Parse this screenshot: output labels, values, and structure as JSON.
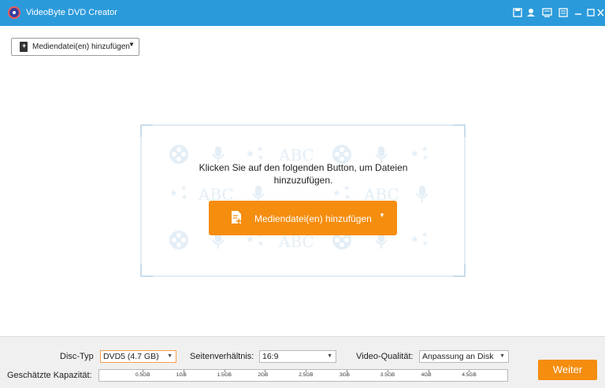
{
  "titlebar": {
    "app_title": "VideoByte DVD Creator",
    "window_buttons": [
      "save-icon",
      "user-icon",
      "feedback-icon",
      "menu-icon",
      "minimize-icon",
      "maximize-icon",
      "close-icon"
    ]
  },
  "toolbar": {
    "add_media_label": "Mediendatei(en) hinzufügen"
  },
  "main": {
    "prompt_line1": "Klicken Sie auf den folgenden Button, um Dateien",
    "prompt_line2": "hinzuzufügen.",
    "add_button_label": "Mediendatei(en) hinzufügen",
    "pattern_text": "ABC"
  },
  "bottom": {
    "disc_type_label": "Disc-Typ",
    "disc_type_value": "DVD5 (4.7 GB)",
    "aspect_label": "Seitenverhältnis:",
    "aspect_value": "16:9",
    "quality_label": "Video-Qualität:",
    "quality_value": "Anpassung an Disk",
    "capacity_label": "Geschätzte Kapazität:",
    "capacity_ticks": [
      "0.5GB",
      "1GB",
      "1.5GB",
      "2GB",
      "2.5GB",
      "3GB",
      "3.5GB",
      "4GB",
      "4.5GB"
    ],
    "next_label": "Weiter"
  },
  "colors": {
    "titlebar": "#2b9adb",
    "accent_orange": "#f58d0f",
    "pattern": "#e4eef6"
  }
}
